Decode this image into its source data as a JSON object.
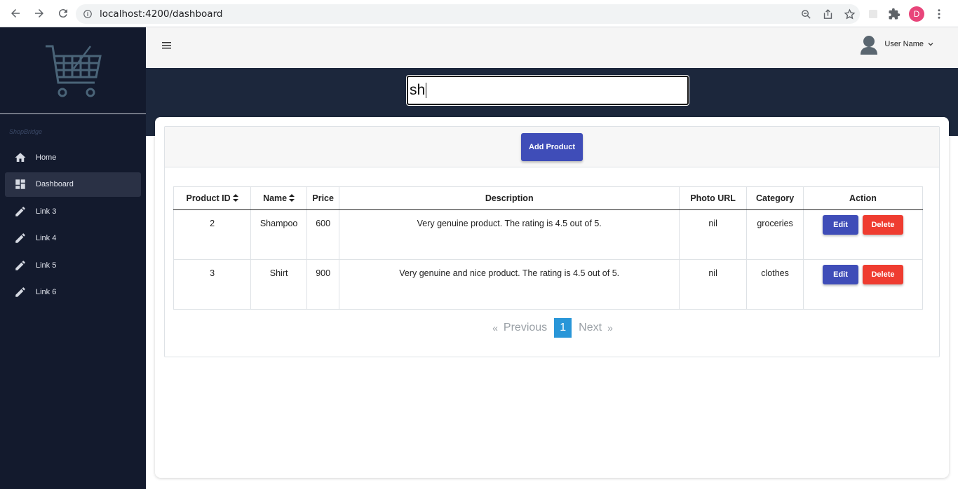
{
  "browser": {
    "url": "localhost:4200/dashboard",
    "profile_initial": "D"
  },
  "sidebar": {
    "brand": "ShopBridge",
    "items": [
      {
        "label": "Home",
        "icon": "home-icon"
      },
      {
        "label": "Dashboard",
        "icon": "dashboard-icon",
        "active": true
      },
      {
        "label": "Link 3",
        "icon": "pencil-icon"
      },
      {
        "label": "Link 4",
        "icon": "pencil-icon"
      },
      {
        "label": "Link 5",
        "icon": "pencil-icon"
      },
      {
        "label": "Link 6",
        "icon": "pencil-icon"
      }
    ]
  },
  "header": {
    "user_name": "User Name"
  },
  "search": {
    "value": "sh"
  },
  "main": {
    "add_label": "Add Product",
    "columns": [
      "Product ID",
      "Name",
      "Price",
      "Description",
      "Photo URL",
      "Category",
      "Action"
    ],
    "rows": [
      {
        "id": "2",
        "name": "Shampoo",
        "price": "600",
        "description": "Very genuine product. The rating is 4.5 out of 5.",
        "photo": "nil",
        "category": "groceries"
      },
      {
        "id": "3",
        "name": "Shirt",
        "price": "900",
        "description": "Very genuine and nice product. The rating is 4.5 out of 5.",
        "photo": "nil",
        "category": "clothes"
      }
    ],
    "edit_label": "Edit",
    "delete_label": "Delete",
    "pager": {
      "first": "«",
      "previous": "Previous",
      "current": "1",
      "next": "Next",
      "last": "»"
    }
  },
  "colors": {
    "sidebar_bg": "#131a2d",
    "band_bg": "#1c273c",
    "primary": "#3f4db8",
    "danger": "#ef3c30",
    "pager_active": "#2996d8"
  }
}
